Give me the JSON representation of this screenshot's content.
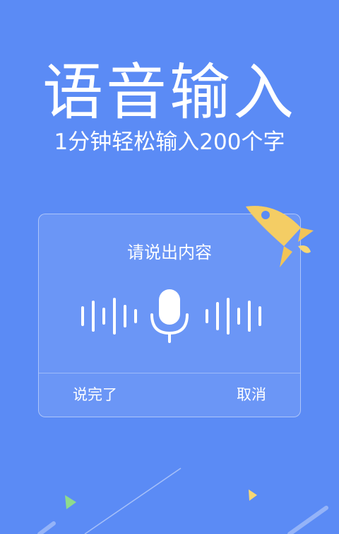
{
  "banner": {
    "title": "语音输入",
    "subtitle": "1分钟轻松输入200个字"
  },
  "dialog": {
    "prompt": "请说出内容",
    "done_label": "说完了",
    "cancel_label": "取消"
  },
  "icons": {
    "microphone": "microphone-icon",
    "rocket": "rocket-icon",
    "sound_wave": "sound-wave-icon"
  },
  "colors": {
    "background": "#5B8BF5",
    "rocket": "#F7D774",
    "triangle_green": "#8EDB8C",
    "triangle_yellow": "#F7D774"
  }
}
